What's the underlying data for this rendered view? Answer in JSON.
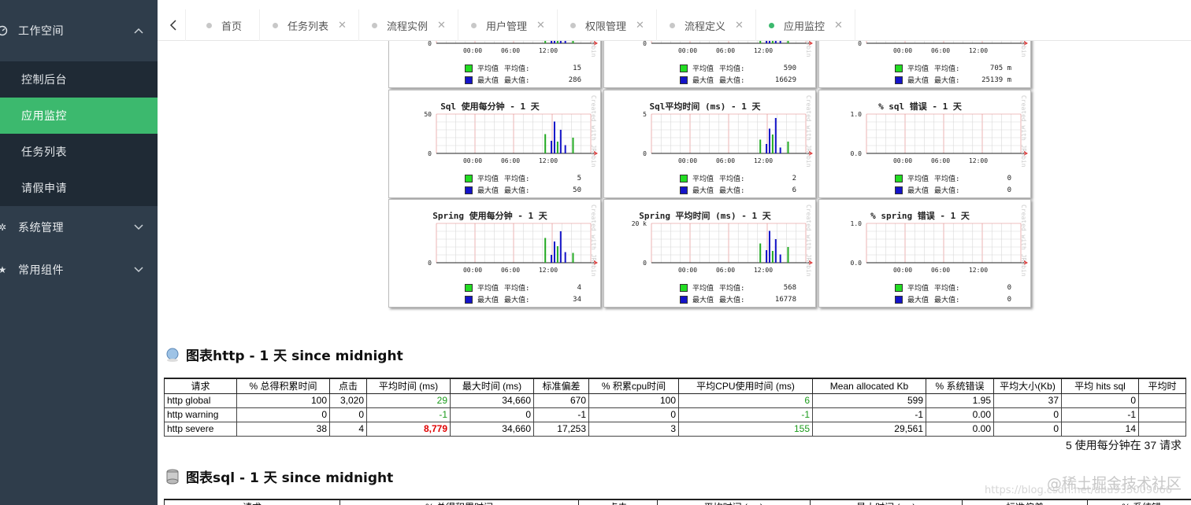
{
  "sidebar": {
    "group_workspace": {
      "label": "工作空间",
      "icon": "dashboard-icon"
    },
    "sub_items": [
      {
        "label": "控制后台"
      },
      {
        "label": "应用监控",
        "active": true
      },
      {
        "label": "任务列表"
      },
      {
        "label": "请假申请"
      }
    ],
    "group_system": {
      "label": "系统管理",
      "icon": "gear-icon"
    },
    "group_components": {
      "label": "常用组件",
      "icon": "star-icon"
    },
    "colors": {
      "bg": "#2f3d4b",
      "submenu_bg": "#1f2a35",
      "active": "#3cb96e"
    }
  },
  "tabs": [
    {
      "label": "首页",
      "closable": false
    },
    {
      "label": "任务列表",
      "closable": true
    },
    {
      "label": "流程实例",
      "closable": true
    },
    {
      "label": "用户管理",
      "closable": true
    },
    {
      "label": "权限管理",
      "closable": true
    },
    {
      "label": "流程定义",
      "closable": true
    },
    {
      "label": "应用监控",
      "closable": true,
      "active": true
    }
  ],
  "graphs": {
    "time_labels": [
      "00:00",
      "06:00",
      "12:00"
    ],
    "legend_avg": "平均值",
    "legend_max": "最大值",
    "legend_avg_k": "平均值:",
    "legend_max_k": "最大值:",
    "side_text": "Created with JRobin",
    "rows": [
      [
        {
          "title": "",
          "ymax": "",
          "avg": "15",
          "max": "286",
          "y0": "0"
        },
        {
          "title": "",
          "ymax": "",
          "avg": "590",
          "max": "16629",
          "y0": "0"
        },
        {
          "title": "",
          "ymax": "",
          "avg": "705 m",
          "max": "25139 m",
          "y0": "0"
        }
      ],
      [
        {
          "title": "Sql 使用每分钟 - 1 天",
          "ymax": "50",
          "avg": "5",
          "max": "50",
          "y0": "0"
        },
        {
          "title": "Sql平均时间 (ms) - 1 天",
          "ymax": "5",
          "avg": "2",
          "max": "6",
          "y0": "0"
        },
        {
          "title": "% sql 错误 - 1 天",
          "ymax": "1.0",
          "avg": "0",
          "max": "0",
          "y0": "0.0"
        }
      ],
      [
        {
          "title": "Spring 使用每分钟 - 1 天",
          "ymax": "",
          "avg": "4",
          "max": "34",
          "y0": "0"
        },
        {
          "title": "Spring 平均时间 (ms) - 1 天",
          "ymax": "20 k",
          "avg": "568",
          "max": "16778",
          "y0": "0"
        },
        {
          "title": "% spring 错误 - 1 天",
          "ymax": "1.0",
          "avg": "0",
          "max": "0",
          "y0": "0.0"
        }
      ]
    ]
  },
  "http_section": {
    "title": "图表http - 1 天 since midnight",
    "headers": [
      "请求",
      "% 总得积累时间",
      "点击",
      "平均时间 (ms)",
      "最大时间 (ms)",
      "标准偏差",
      "% 积累cpu时间",
      "平均CPU使用时间 (ms)",
      "Mean allocated Kb",
      "% 系统错误",
      "平均大小(Kb)",
      "平均 hits sql",
      "平均时"
    ],
    "rows": [
      [
        "http global",
        "100",
        "3,020",
        "29",
        "34,660",
        "670",
        "100",
        "6",
        "599",
        "1.95",
        "37",
        "0",
        ""
      ],
      [
        "http warning",
        "0",
        "0",
        "-1",
        "0",
        "-1",
        "0",
        "-1",
        "-1",
        "0.00",
        "0",
        "-1",
        ""
      ],
      [
        "http severe",
        "38",
        "4",
        "8,779",
        "34,660",
        "17,253",
        "3",
        "155",
        "29,561",
        "0.00",
        "0",
        "14",
        ""
      ]
    ],
    "summary": "5 使用每分钟在 37 请求"
  },
  "sql_section": {
    "title": "图表sql - 1 天 since midnight",
    "headers": [
      "请求",
      "% 总得积累时间",
      "点击",
      "平均时间 (ms)",
      "最大时间 (ms)",
      "标准偏差",
      "% 系统错"
    ]
  },
  "watermark": {
    "text": "@稀土掘金技术社区",
    "url": "https://blog.csdn.net/abu935009066"
  }
}
